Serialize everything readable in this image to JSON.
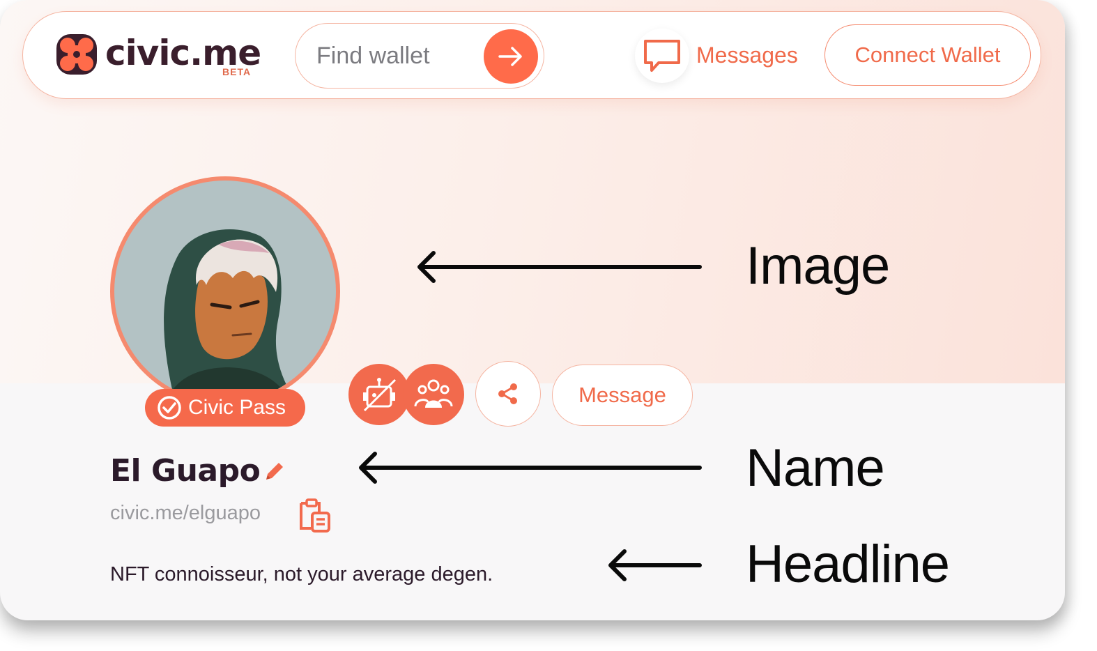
{
  "nav": {
    "logo_text": "civic.me",
    "logo_badge": "BETA",
    "search_placeholder": "Find wallet",
    "messages_label": "Messages",
    "connect_wallet_label": "Connect Wallet"
  },
  "profile": {
    "pass_label": "Civic Pass",
    "message_button_label": "Message",
    "name": "El Guapo",
    "url": "civic.me/elguapo",
    "headline": "NFT connoisseur, not your average degen."
  },
  "annotations": {
    "image_label": "Image",
    "name_label": "Name",
    "headline_label": "Headline"
  },
  "colors": {
    "accent": "#f26a4d",
    "text_dark": "#2b1a2a",
    "text_muted": "#9a9a9e"
  },
  "icons": [
    "logo-mark-icon",
    "arrow-right-icon",
    "message-bubble-icon",
    "check-circle-icon",
    "no-bot-icon",
    "community-icon",
    "share-icon",
    "pencil-icon",
    "clipboard-icon",
    "annotation-arrow-icon"
  ]
}
